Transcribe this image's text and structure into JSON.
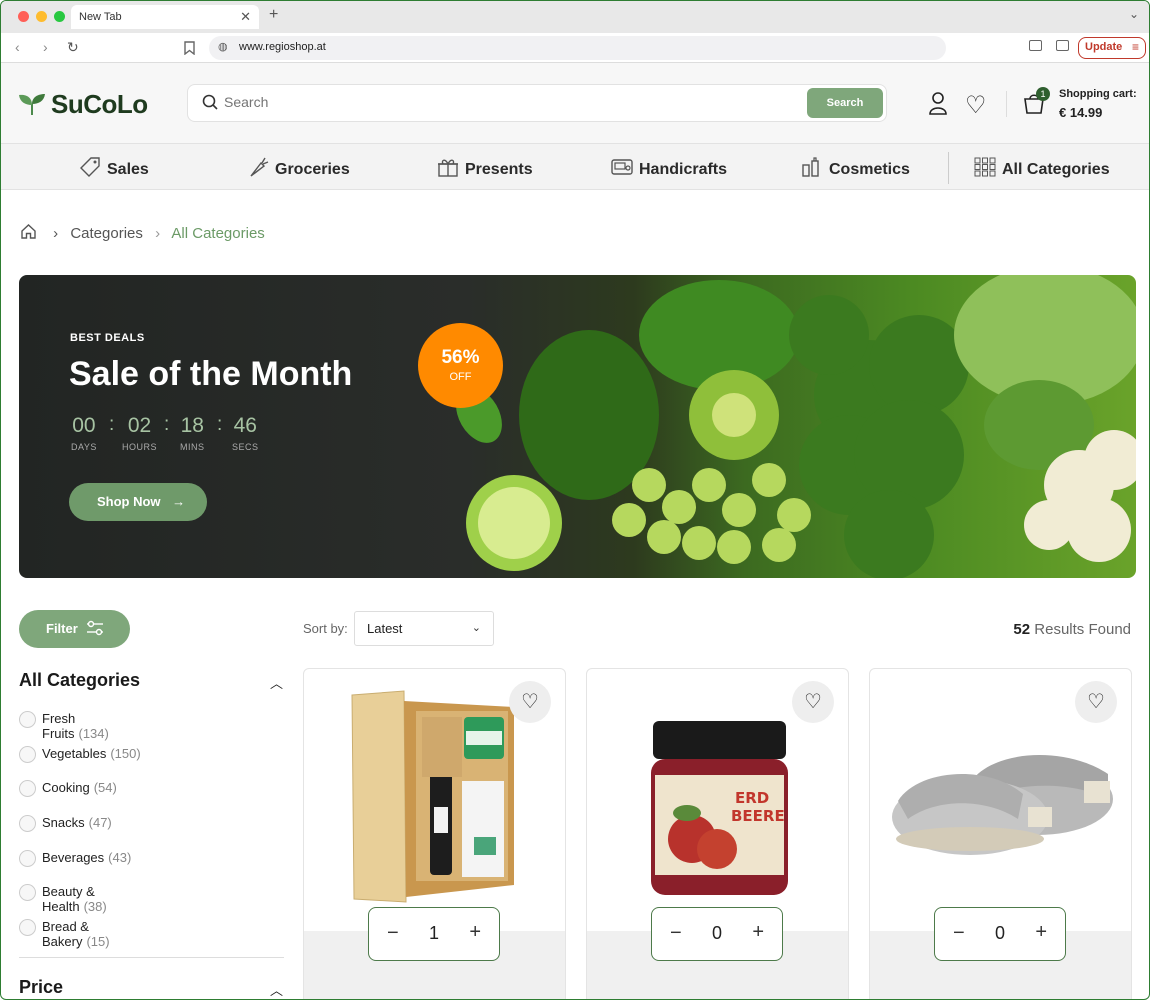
{
  "browser": {
    "tab_title": "New Tab",
    "url": "www.regioshop.at",
    "update_label": "Update"
  },
  "header": {
    "logo": "SuCoLo",
    "search_placeholder": "Search",
    "search_button": "Search",
    "cart_label": "Shopping cart:",
    "cart_total": "€ 14.99",
    "cart_count": "1"
  },
  "nav": {
    "items": [
      {
        "label": "Sales",
        "icon": "tag-icon"
      },
      {
        "label": "Groceries",
        "icon": "carrot-icon"
      },
      {
        "label": "Presents",
        "icon": "gift-icon"
      },
      {
        "label": "Handicrafts",
        "icon": "sewing-machine-icon"
      },
      {
        "label": "Cosmetics",
        "icon": "cosmetics-bottles-icon"
      },
      {
        "label": "All Categories",
        "icon": "grid-icon"
      }
    ]
  },
  "breadcrumb": {
    "items": [
      "Categories",
      "All Categories"
    ]
  },
  "hero": {
    "kicker": "BEST DEALS",
    "title": "Sale of the Month",
    "countdown": [
      {
        "value": "00",
        "label": "DAYS"
      },
      {
        "value": "02",
        "label": "HOURS"
      },
      {
        "value": "18",
        "label": "MINS"
      },
      {
        "value": "46",
        "label": "SECS"
      }
    ],
    "button": "Shop Now",
    "badge_pct": "56%",
    "badge_txt": "OFF"
  },
  "toolbar": {
    "filter_label": "Filter",
    "sort_label": "Sort by:",
    "sort_value": "Latest",
    "results_count": "52",
    "results_label": "Results Found"
  },
  "sidebar": {
    "title": "All Categories",
    "categories": [
      {
        "name": "Fresh Fruits",
        "count": "(134)"
      },
      {
        "name": "Vegetables",
        "count": "(150)"
      },
      {
        "name": "Cooking",
        "count": "(54)"
      },
      {
        "name": "Snacks",
        "count": "(47)"
      },
      {
        "name": "Beverages",
        "count": "(43)"
      },
      {
        "name": "Beauty & Health",
        "count": "(38)"
      },
      {
        "name": "Bread & Bakery",
        "count": "(15)"
      }
    ],
    "price_title": "Price"
  },
  "products": [
    {
      "image": "gift-box-image",
      "qty": "1"
    },
    {
      "image": "strawberry-jam-jar-image",
      "qty": "0"
    },
    {
      "image": "felt-slippers-image",
      "qty": "0"
    }
  ],
  "colors": {
    "brand_green": "#7fa77b",
    "dark_green": "#2f5f2f",
    "offer_orange": "#ff8a00"
  }
}
